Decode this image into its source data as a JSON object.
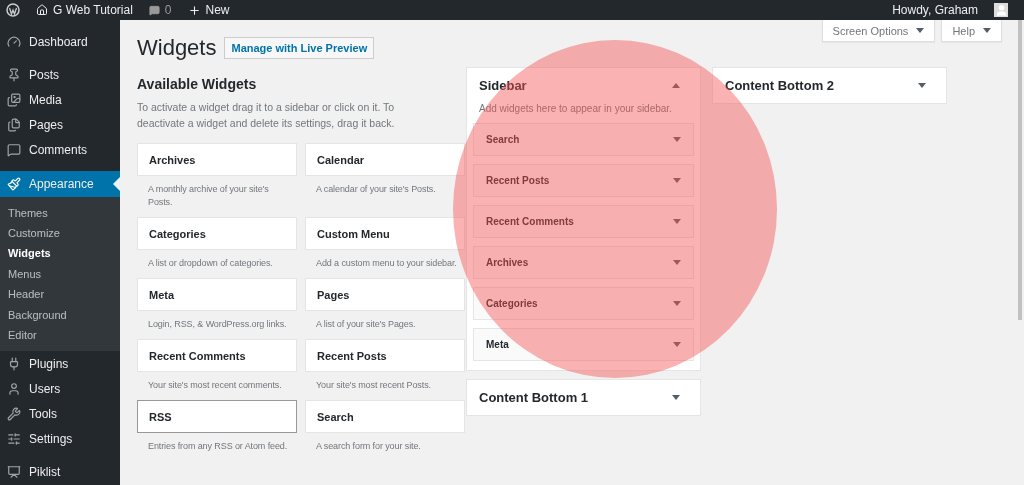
{
  "admin_bar": {
    "site_name": "G Web Tutorial",
    "comments_count": "0",
    "new_label": "New",
    "greeting": "Howdy, Graham"
  },
  "admin_menu": [
    {
      "label": "Dashboard",
      "current": false
    },
    {
      "label": "Posts",
      "current": false
    },
    {
      "label": "Media",
      "current": false
    },
    {
      "label": "Pages",
      "current": false
    },
    {
      "label": "Comments",
      "current": false
    },
    {
      "label": "Appearance",
      "current": true,
      "submenu": [
        {
          "label": "Themes",
          "current": false
        },
        {
          "label": "Customize",
          "current": false
        },
        {
          "label": "Widgets",
          "current": true
        },
        {
          "label": "Menus",
          "current": false
        },
        {
          "label": "Header",
          "current": false
        },
        {
          "label": "Background",
          "current": false
        },
        {
          "label": "Editor",
          "current": false
        }
      ]
    },
    {
      "label": "Plugins",
      "current": false
    },
    {
      "label": "Users",
      "current": false
    },
    {
      "label": "Tools",
      "current": false
    },
    {
      "label": "Settings",
      "current": false
    },
    {
      "label": "Piklist",
      "current": false
    }
  ],
  "header": {
    "title": "Widgets",
    "action_button": "Manage with Live Preview"
  },
  "screen_tabs": [
    "Screen Options",
    "Help"
  ],
  "available_widgets": {
    "title": "Available Widgets",
    "description": "To activate a widget drag it to a sidebar or click on it. To deactivate a widget and delete its settings, drag it back.",
    "widgets": [
      {
        "name": "Archives",
        "description": "A monthly archive of your site's Posts.",
        "selected": false
      },
      {
        "name": "Calendar",
        "description": "A calendar of your site's Posts.",
        "selected": false
      },
      {
        "name": "Categories",
        "description": "A list or dropdown of categories.",
        "selected": false
      },
      {
        "name": "Custom Menu",
        "description": "Add a custom menu to your sidebar.",
        "selected": false
      },
      {
        "name": "Meta",
        "description": "Login, RSS, & WordPress.org links.",
        "selected": false
      },
      {
        "name": "Pages",
        "description": "A list of your site's Pages.",
        "selected": false
      },
      {
        "name": "Recent Comments",
        "description": "Your site's most recent comments.",
        "selected": false
      },
      {
        "name": "Recent Posts",
        "description": "Your site's most recent Posts.",
        "selected": false
      },
      {
        "name": "RSS",
        "description": "Entries from any RSS or Atom feed.",
        "selected": true
      },
      {
        "name": "Search",
        "description": "A search form for your site.",
        "selected": false
      }
    ]
  },
  "widget_area_columns": [
    [
      {
        "title": "Sidebar",
        "expanded": true,
        "description": "Add widgets here to appear in your sidebar.",
        "widgets": [
          "Search",
          "Recent Posts",
          "Recent Comments",
          "Archives",
          "Categories",
          "Meta"
        ]
      },
      {
        "title": "Content Bottom 1",
        "expanded": false
      }
    ],
    [
      {
        "title": "Content Bottom 2",
        "expanded": false
      }
    ]
  ]
}
